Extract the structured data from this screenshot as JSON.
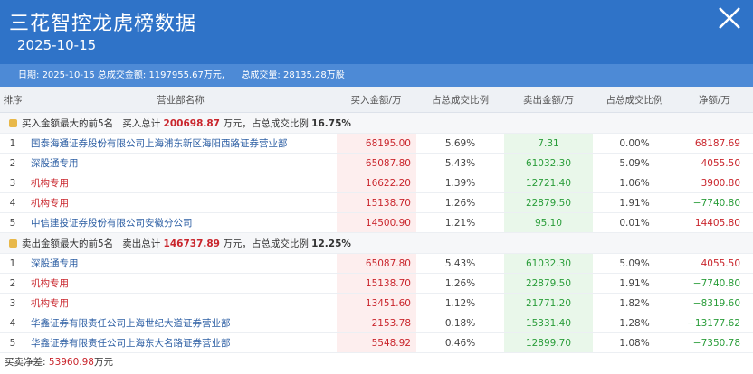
{
  "header": {
    "title": "三花智控龙虎榜数据",
    "date": "2025-10-15"
  },
  "summary": {
    "date_label": "日期:",
    "date": "2025-10-15",
    "turnover_label": "总成交金额:",
    "turnover": "1197955.67万元,",
    "volume_label": "总成交量:",
    "volume": "28135.28万股"
  },
  "table": {
    "headers": [
      "排序",
      "营业部名称",
      "买入金额/万",
      "占总成交比例",
      "卖出金额/万",
      "占总成交比例",
      "净额/万"
    ],
    "buy_section": {
      "label": "买入金额最大的前5名",
      "total_label": "买入总计",
      "total": "200698.87",
      "unit": "万元，占总成交比例",
      "pct": "16.75%"
    },
    "buy_rows": [
      {
        "rank": "1",
        "name": "国泰海通证券股份有限公司上海浦东新区海阳西路证券营业部",
        "name_color": "blue",
        "buy": "68195.00",
        "buy_pct": "5.69%",
        "sell": "7.31",
        "sell_pct": "0.00%",
        "net": "68187.69",
        "net_dir": "up"
      },
      {
        "rank": "2",
        "name": "深股通专用",
        "name_color": "blue",
        "buy": "65087.80",
        "buy_pct": "5.43%",
        "sell": "61032.30",
        "sell_pct": "5.09%",
        "net": "4055.50",
        "net_dir": "up"
      },
      {
        "rank": "3",
        "name": "机构专用",
        "name_color": "red",
        "buy": "16622.20",
        "buy_pct": "1.39%",
        "sell": "12721.40",
        "sell_pct": "1.06%",
        "net": "3900.80",
        "net_dir": "up"
      },
      {
        "rank": "4",
        "name": "机构专用",
        "name_color": "red",
        "buy": "15138.70",
        "buy_pct": "1.26%",
        "sell": "22879.50",
        "sell_pct": "1.91%",
        "net": "−7740.80",
        "net_dir": "down"
      },
      {
        "rank": "5",
        "name": "中信建投证券股份有限公司安徽分公司",
        "name_color": "blue",
        "buy": "14500.90",
        "buy_pct": "1.21%",
        "sell": "95.10",
        "sell_pct": "0.01%",
        "net": "14405.80",
        "net_dir": "up"
      }
    ],
    "sell_section": {
      "label": "卖出金额最大的前5名",
      "total_label": "卖出总计",
      "total": "146737.89",
      "unit": "万元，占总成交比例",
      "pct": "12.25%"
    },
    "sell_rows": [
      {
        "rank": "1",
        "name": "深股通专用",
        "name_color": "blue",
        "buy": "65087.80",
        "buy_pct": "5.43%",
        "sell": "61032.30",
        "sell_pct": "5.09%",
        "net": "4055.50",
        "net_dir": "up"
      },
      {
        "rank": "2",
        "name": "机构专用",
        "name_color": "red",
        "buy": "15138.70",
        "buy_pct": "1.26%",
        "sell": "22879.50",
        "sell_pct": "1.91%",
        "net": "−7740.80",
        "net_dir": "down"
      },
      {
        "rank": "3",
        "name": "机构专用",
        "name_color": "red",
        "buy": "13451.60",
        "buy_pct": "1.12%",
        "sell": "21771.20",
        "sell_pct": "1.82%",
        "net": "−8319.60",
        "net_dir": "down"
      },
      {
        "rank": "4",
        "name": "华鑫证券有限责任公司上海世纪大道证券营业部",
        "name_color": "blue",
        "buy": "2153.78",
        "buy_pct": "0.18%",
        "sell": "15331.40",
        "sell_pct": "1.28%",
        "net": "−13177.62",
        "net_dir": "down"
      },
      {
        "rank": "5",
        "name": "华鑫证券有限责任公司上海东大名路证券营业部",
        "name_color": "blue",
        "buy": "5548.92",
        "buy_pct": "0.46%",
        "sell": "12899.70",
        "sell_pct": "1.08%",
        "net": "−7350.78",
        "net_dir": "down"
      }
    ]
  },
  "footer": {
    "label": "买卖净差:",
    "value": "53960.98",
    "unit": "万元"
  },
  "colors": {
    "header_bg": "#2f73c8",
    "summary_bg": "#4d8ad6",
    "up": "#c9252c",
    "down": "#2a9d3a"
  },
  "icons": {
    "close": "close-icon",
    "section": "square-badge-icon"
  }
}
